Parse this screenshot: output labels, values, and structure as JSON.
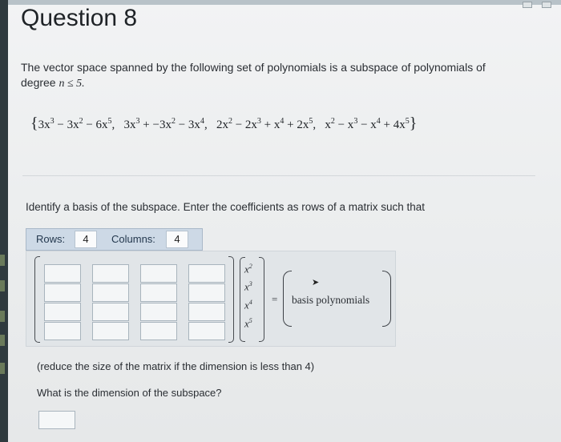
{
  "question_title": "Question 8",
  "prompt": {
    "text": "The vector space spanned by the following set of polynomials is a subspace of polynomials of degree",
    "condition": "n ≤ 5."
  },
  "polynomial_set": {
    "open": "{",
    "p1": {
      "a": "3x",
      "a_exp": "3",
      "b": " − 3x",
      "b_exp": "2",
      "c": " − 6x",
      "c_exp": "5"
    },
    "p2": {
      "a": "3x",
      "a_exp": "3",
      "b": " + −3x",
      "b_exp": "2",
      "c": " − 3x",
      "c_exp": "4"
    },
    "p3": {
      "a": "2x",
      "a_exp": "2",
      "b": " − 2x",
      "b_exp": "3",
      "c": " + x",
      "c_exp": "4",
      "d": " + 2x",
      "d_exp": "5"
    },
    "p4": {
      "a": "x",
      "a_exp": "2",
      "b": " − x",
      "b_exp": "3",
      "c": " − x",
      "c_exp": "4",
      "d": " + 4x",
      "d_exp": "5"
    },
    "sep": ",",
    "close": "}"
  },
  "instruction": "Identify a basis of the subspace. Enter the coefficients as rows of a matrix such that",
  "dimensions": {
    "rows_label": "Rows:",
    "rows_value": "4",
    "columns_label": "Columns:",
    "columns_value": "4"
  },
  "matrix": {
    "rows": 4,
    "cols": 4,
    "cells": [
      [
        "",
        "",
        "",
        ""
      ],
      [
        "",
        "",
        "",
        ""
      ],
      [
        "",
        "",
        "",
        ""
      ],
      [
        "",
        "",
        "",
        ""
      ]
    ]
  },
  "vector": {
    "base": "x",
    "exponents": [
      "2",
      "3",
      "4",
      "5"
    ]
  },
  "equals": "=",
  "basis_label": "basis polynomials",
  "note": "(reduce the size of the matrix if the dimension is less than 4)",
  "dimension_question": "What is the dimension of the subspace?",
  "dimension_answer": ""
}
